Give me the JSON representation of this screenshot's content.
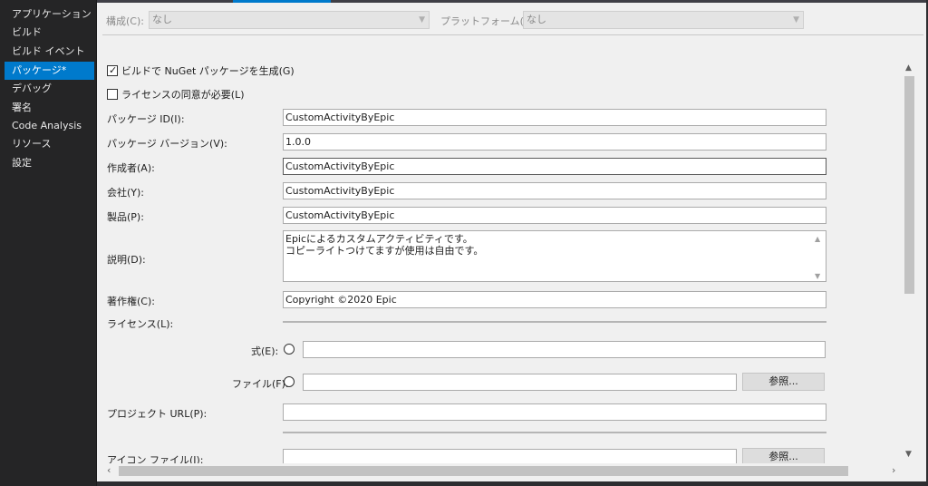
{
  "sidebar": {
    "items": [
      {
        "label": "アプリケーション"
      },
      {
        "label": "ビルド"
      },
      {
        "label": "ビルド イベント"
      },
      {
        "label": "パッケージ*",
        "active": true
      },
      {
        "label": "デバッグ"
      },
      {
        "label": "署名"
      },
      {
        "label": "Code Analysis"
      },
      {
        "label": "リソース"
      },
      {
        "label": "設定"
      }
    ]
  },
  "config_bar": {
    "configuration_label": "構成(C):",
    "configuration_value": "なし",
    "platform_label": "プラットフォーム(M):",
    "platform_value": "なし"
  },
  "form": {
    "generate_on_build": {
      "label": "ビルドで NuGet パッケージを生成(G)",
      "checked": true
    },
    "require_license": {
      "label": "ライセンスの同意が必要(L)",
      "checked": false
    },
    "package_id": {
      "label": "パッケージ ID(I):",
      "value": "CustomActivityByEpic"
    },
    "package_version": {
      "label": "パッケージ バージョン(V):",
      "value": "1.0.0"
    },
    "authors": {
      "label": "作成者(A):",
      "value": "CustomActivityByEpic"
    },
    "company": {
      "label": "会社(Y):",
      "value": "CustomActivityByEpic"
    },
    "product": {
      "label": "製品(P):",
      "value": "CustomActivityByEpic"
    },
    "description": {
      "label": "説明(D):",
      "line1": "Epicによるカスタムアクティビティです。",
      "line2": "コピーライトつけてますが使用は自由です。"
    },
    "copyright": {
      "label": "著作権(C):",
      "value": "Copyright ©2020 Epic"
    },
    "license": {
      "label": "ライセンス(L):",
      "expression_label": "式(E):",
      "expression_value": "",
      "file_label": "ファイル(F):",
      "file_value": "",
      "browse_label": "参照..."
    },
    "project_url": {
      "label": "プロジェクト URL(P):",
      "value": ""
    },
    "icon_file": {
      "label": "アイコン ファイル(I):",
      "value": "",
      "browse_label": "参照..."
    }
  },
  "icons": {
    "dropdown": "chevron-down-icon",
    "scroll_up": "chevron-up-icon",
    "scroll_down": "chevron-down-icon",
    "scroll_left": "chevron-left-icon",
    "scroll_right": "chevron-right-icon",
    "check": "checkmark-icon"
  },
  "colors": {
    "accent": "#007acc",
    "sidebar_bg": "#252526",
    "content_bg": "#f0f0f0"
  }
}
